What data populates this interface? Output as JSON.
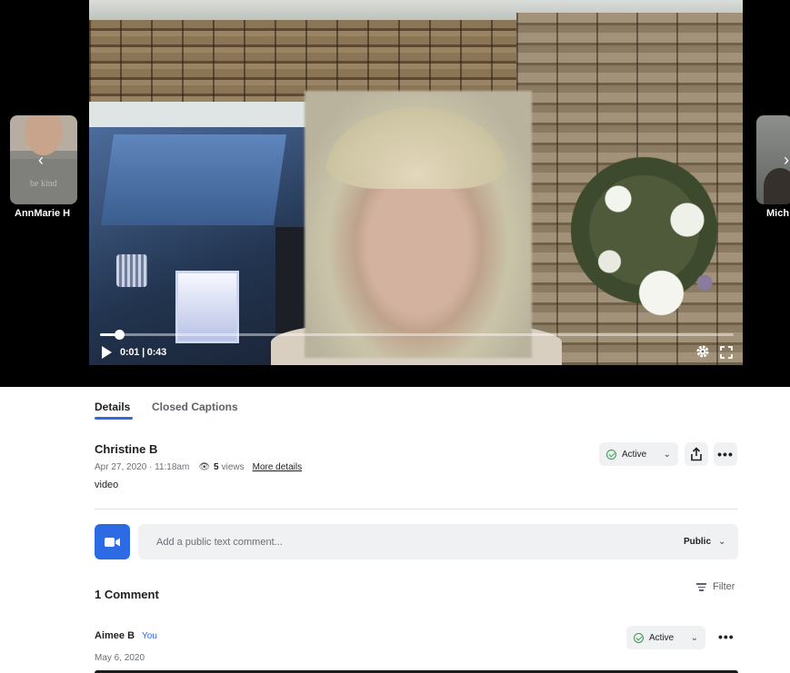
{
  "player": {
    "current_time": "0:01",
    "duration": "0:43",
    "time_display": "0:01 | 0:43",
    "progress_fraction": 0.03,
    "controls": {
      "play_icon": "play-icon",
      "settings_icon": "gear-icon",
      "fullscreen_icon": "fullscreen-icon"
    }
  },
  "carousel": {
    "prev": {
      "name": "AnnMarie H",
      "shirt_text": "be kind",
      "icon": "chevron-left-icon"
    },
    "next": {
      "name": "Mich",
      "icon": "chevron-right-icon"
    }
  },
  "tabs": [
    {
      "label": "Details",
      "active": true
    },
    {
      "label": "Closed Captions",
      "active": false
    }
  ],
  "video": {
    "author": "Christine B",
    "date": "Apr 27, 2020 · 11:18am",
    "views_count": "5",
    "views_label": "views",
    "more_details": "More details",
    "description": "video",
    "status": "Active"
  },
  "composer": {
    "placeholder": "Add a public text comment...",
    "visibility": "Public"
  },
  "comments": {
    "count_label": "1 Comment",
    "filter_label": "Filter",
    "items": [
      {
        "author": "Aimee B",
        "you_tag": "You",
        "date": "May 6, 2020",
        "status": "Active"
      }
    ]
  },
  "colors": {
    "accent": "#2d6be4",
    "status_green": "#2f9e4f",
    "pill_bg": "#f0f1f2",
    "stage_bg": "#000000"
  }
}
